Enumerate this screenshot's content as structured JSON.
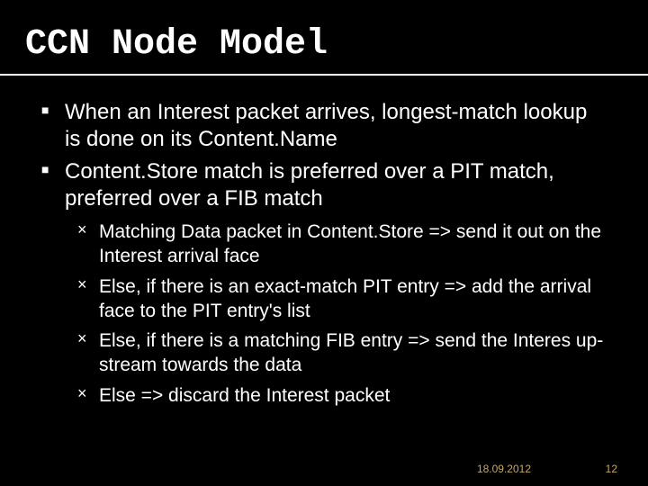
{
  "title": "CCN Node Model",
  "bullets": [
    "When an Interest packet arrives, longest-match lookup is done on its Content.Name",
    "Content.Store match is preferred over a PIT match, preferred over a FIB match"
  ],
  "sub_bullets": [
    "Matching Data packet in Content.Store => send it out on the Interest arrival face",
    "Else, if there is an exact-match PIT entry => add the arrival face to the PIT entry's list",
    "Else, if there is a matching FIB entry => send the Interes up-stream towards the data",
    "Else => discard the Interest packet"
  ],
  "footer": {
    "date": "18.09.2012",
    "page": "12"
  }
}
